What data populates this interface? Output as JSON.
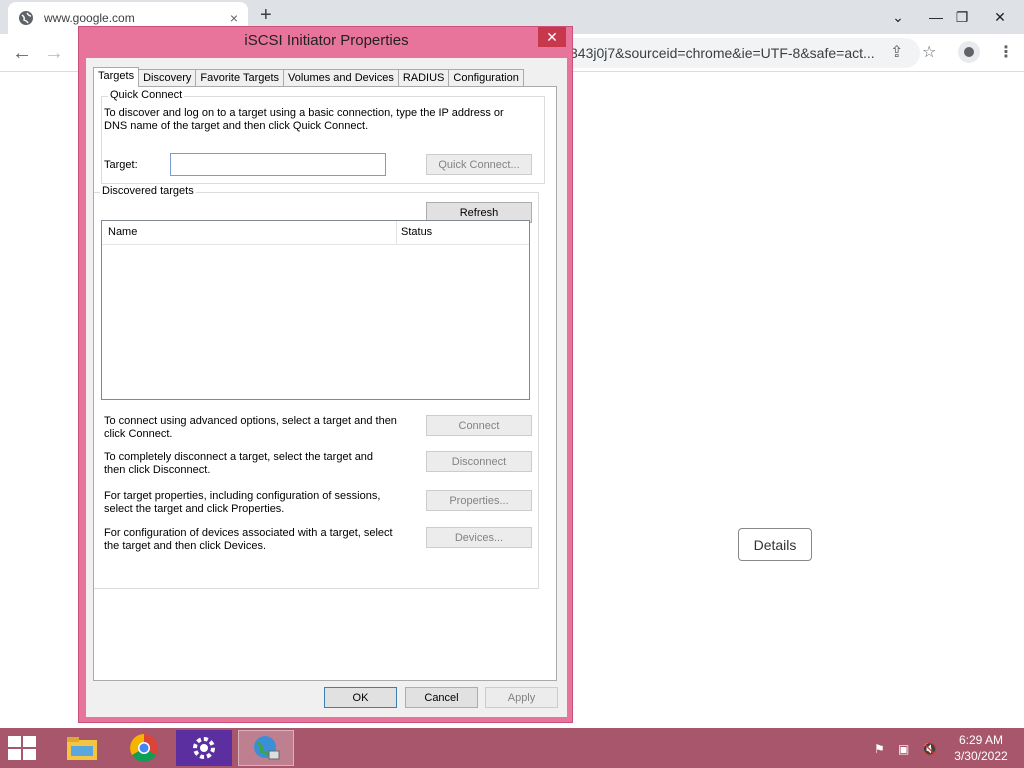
{
  "browser": {
    "tab_title": "www.google.com",
    "tab_close": "×",
    "new_tab": "+",
    "url_visible": "343j0j7&sourceid=chrome&ie=UTF-8&safe=act...",
    "back": "←",
    "forward": "→"
  },
  "page": {
    "details_label": "Details"
  },
  "dialog": {
    "title": "iSCSI Initiator Properties",
    "close": "✕",
    "tabs": [
      "Targets",
      "Discovery",
      "Favorite Targets",
      "Volumes and Devices",
      "RADIUS",
      "Configuration"
    ],
    "quick_connect": {
      "label": "Quick Connect",
      "description_line1": "To discover and log on to a target using a basic connection, type the IP address or",
      "description_line2": "DNS name of the target and then click Quick Connect.",
      "target_label": "Target:",
      "target_value": "",
      "button": "Quick Connect..."
    },
    "discovered": {
      "label": "Discovered targets",
      "refresh": "Refresh",
      "columns": [
        "Name",
        "Status"
      ],
      "rows": []
    },
    "actions": [
      {
        "line1": "To connect using advanced options, select a target and then",
        "line2": "click Connect.",
        "button": "Connect"
      },
      {
        "line1": "To completely disconnect a target, select the target and",
        "line2": "then click Disconnect.",
        "button": "Disconnect"
      },
      {
        "line1": "For target properties, including configuration of sessions,",
        "line2": "select the target and click Properties.",
        "button": "Properties..."
      },
      {
        "line1": "For configuration of devices associated with a target, select",
        "line2": "the target and then click Devices.",
        "button": "Devices..."
      }
    ],
    "footer": {
      "ok": "OK",
      "cancel": "Cancel",
      "apply": "Apply"
    }
  },
  "taskbar": {
    "time": "6:29 AM",
    "date": "3/30/2022"
  },
  "colors": {
    "dialog_border": "#e8739b",
    "taskbar": "#a8566c",
    "close_button": "#c8384d"
  }
}
